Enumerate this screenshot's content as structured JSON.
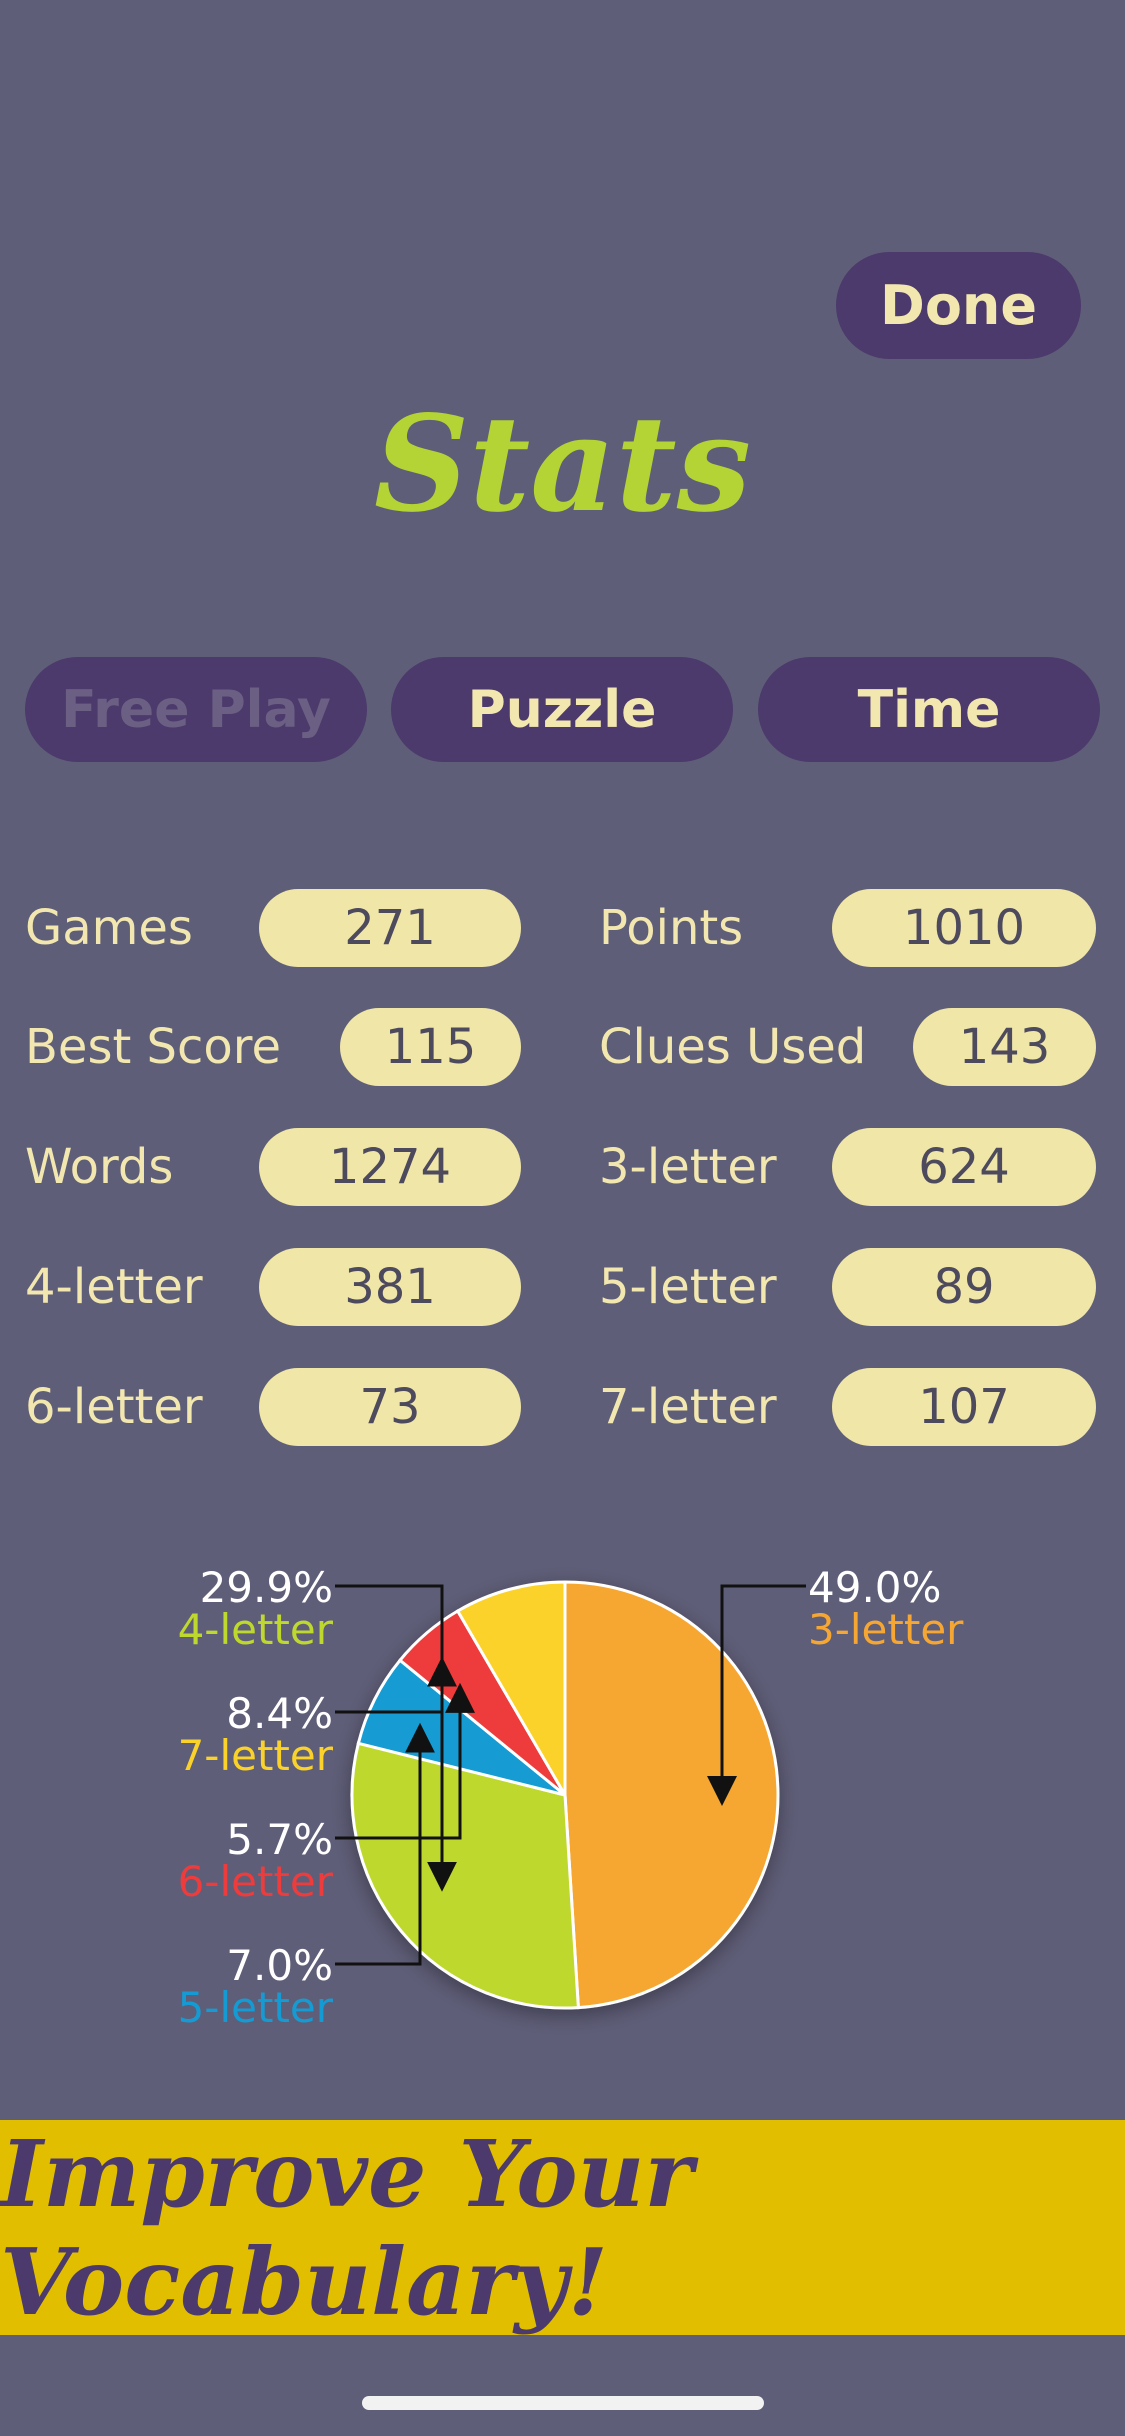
{
  "header": {
    "done_label": "Done",
    "title": "Stats"
  },
  "tabs": [
    {
      "label": "Free Play",
      "state": "disabled"
    },
    {
      "label": "Puzzle",
      "state": "active"
    },
    {
      "label": "Time",
      "state": "active"
    }
  ],
  "stats": [
    {
      "label": "Games",
      "value": "271"
    },
    {
      "label": "Points",
      "value": "1010"
    },
    {
      "label": "Best Score",
      "value": "115"
    },
    {
      "label": "Clues Used",
      "value": "143"
    },
    {
      "label": "Words",
      "value": "1274"
    },
    {
      "label": "3-letter",
      "value": "624"
    },
    {
      "label": "4-letter",
      "value": "381"
    },
    {
      "label": "5-letter",
      "value": "89"
    },
    {
      "label": "6-letter",
      "value": "73"
    },
    {
      "label": "7-letter",
      "value": "107"
    }
  ],
  "chart_data": {
    "type": "pie",
    "title": "",
    "slices": [
      {
        "name": "3-letter",
        "value": 49.0,
        "label": "49.0%",
        "color": "#f6a733"
      },
      {
        "name": "4-letter",
        "value": 29.9,
        "label": "29.9%",
        "color": "#bfd82e"
      },
      {
        "name": "5-letter",
        "value": 7.0,
        "label": "7.0%",
        "color": "#159bd3"
      },
      {
        "name": "6-letter",
        "value": 5.7,
        "label": "5.7%",
        "color": "#ee3b3b"
      },
      {
        "name": "7-letter",
        "value": 8.4,
        "label": "8.4%",
        "color": "#fbd22a"
      }
    ]
  },
  "banner": {
    "text": "Improve Your Vocabulary!"
  },
  "colors": {
    "background": "#5f5e78",
    "button": "#4b3a6b",
    "accent": "#b4d334",
    "pill": "#f0e6a8",
    "banner": "#e1bf00"
  }
}
